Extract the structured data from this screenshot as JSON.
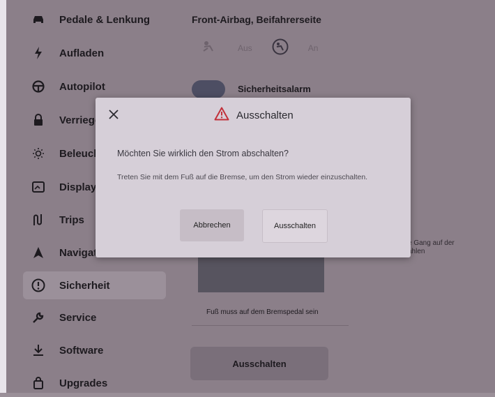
{
  "sidebar": {
    "items": [
      {
        "label": "Pedale & Lenkung",
        "icon": "car-icon"
      },
      {
        "label": "Aufladen",
        "icon": "bolt-icon"
      },
      {
        "label": "Autopilot",
        "icon": "steering-wheel-icon"
      },
      {
        "label": "Verriegel",
        "icon": "lock-icon"
      },
      {
        "label": "Beleucht",
        "icon": "sun-icon"
      },
      {
        "label": "Display",
        "icon": "display-icon"
      },
      {
        "label": "Trips",
        "icon": "trips-icon"
      },
      {
        "label": "Navigatio",
        "icon": "navigation-icon"
      },
      {
        "label": "Sicherheit",
        "icon": "safety-icon",
        "active": true
      },
      {
        "label": "Service",
        "icon": "wrench-icon"
      },
      {
        "label": "Software",
        "icon": "download-icon"
      },
      {
        "label": "Upgrades",
        "icon": "bag-icon"
      }
    ]
  },
  "main": {
    "airbag_title": "Front-Airbag, Beifahrerseite",
    "airbag_off": "Aus",
    "airbag_on": "An",
    "alarm_label": "Sicherheitsalarm",
    "gear_note": "e Gang auf der\nahlen",
    "brake_note": "Fuß muss auf dem Bremspedal sein",
    "power_off_button": "Ausschalten"
  },
  "dialog": {
    "title": "Ausschalten",
    "question": "Möchten Sie wirklich den Strom abschalten?",
    "info": "Treten Sie mit dem Fuß auf die Bremse, um den Strom wieder einzuschalten.",
    "cancel_label": "Abbrechen",
    "confirm_label": "Ausschalten"
  },
  "colors": {
    "warning": "#c2303a",
    "dim_overlay": "#8b7f89",
    "dialog_bg": "#d6cfd8"
  }
}
